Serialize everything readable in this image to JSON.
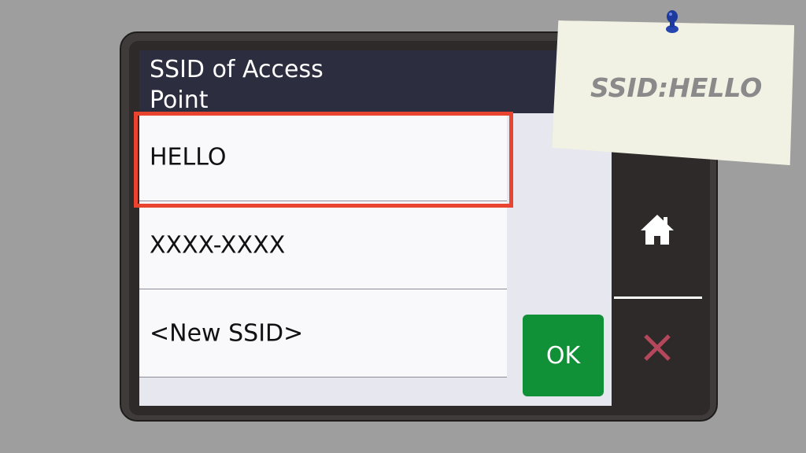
{
  "screen": {
    "title": "SSID of Access\nPoint",
    "list": [
      {
        "label": "HELLO"
      },
      {
        "label": "XXXX-XXXX"
      },
      {
        "label": "<New SSID>"
      }
    ],
    "ok_label": "OK"
  },
  "side_panel": {
    "home_icon": "home-icon",
    "close_icon": "close-icon"
  },
  "note": {
    "text": "SSID:HELLO"
  },
  "colors": {
    "highlight": "#e8442f",
    "ok_button": "#109137",
    "title_bar": "#2d2d40",
    "close_icon": "#b5475c"
  }
}
